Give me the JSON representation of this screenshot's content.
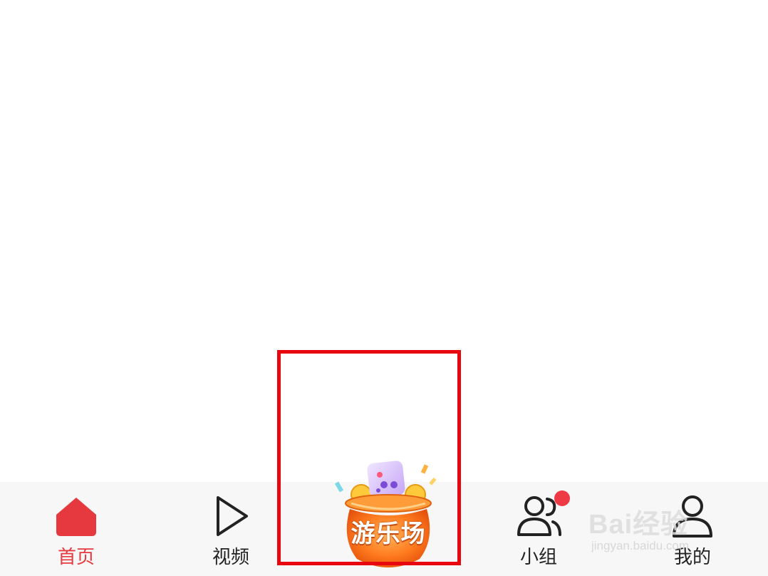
{
  "tabs": [
    {
      "id": "home",
      "label": "首页",
      "icon": "home-icon",
      "active": true
    },
    {
      "id": "video",
      "label": "视频",
      "icon": "play-icon",
      "active": false
    },
    {
      "id": "games",
      "label": "游乐场",
      "icon": "lucky-pot-icon",
      "active": false
    },
    {
      "id": "groups",
      "label": "小组",
      "icon": "group-icon",
      "active": false,
      "badge": true
    },
    {
      "id": "mine",
      "label": "我的",
      "icon": "user-icon",
      "active": false
    }
  ],
  "colors": {
    "accent": "#e5393f",
    "tabbar_bg": "#f7f7f7",
    "highlight": "#e8070f",
    "badge": "#ee3a44"
  },
  "watermark": {
    "brand": "Bai经验",
    "sub": "jingyan.baidu.com"
  }
}
